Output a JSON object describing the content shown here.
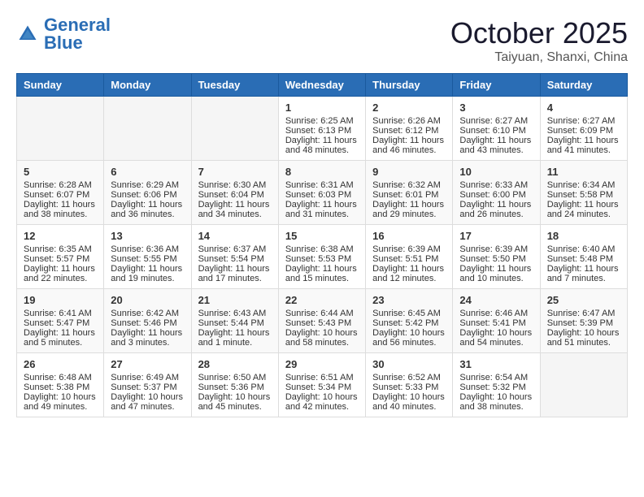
{
  "header": {
    "logo_general": "General",
    "logo_blue": "Blue",
    "month_title": "October 2025",
    "location": "Taiyuan, Shanxi, China"
  },
  "days_of_week": [
    "Sunday",
    "Monday",
    "Tuesday",
    "Wednesday",
    "Thursday",
    "Friday",
    "Saturday"
  ],
  "weeks": [
    [
      {
        "day": "",
        "content": ""
      },
      {
        "day": "",
        "content": ""
      },
      {
        "day": "",
        "content": ""
      },
      {
        "day": "1",
        "content": "Sunrise: 6:25 AM\nSunset: 6:13 PM\nDaylight: 11 hours and 48 minutes."
      },
      {
        "day": "2",
        "content": "Sunrise: 6:26 AM\nSunset: 6:12 PM\nDaylight: 11 hours and 46 minutes."
      },
      {
        "day": "3",
        "content": "Sunrise: 6:27 AM\nSunset: 6:10 PM\nDaylight: 11 hours and 43 minutes."
      },
      {
        "day": "4",
        "content": "Sunrise: 6:27 AM\nSunset: 6:09 PM\nDaylight: 11 hours and 41 minutes."
      }
    ],
    [
      {
        "day": "5",
        "content": "Sunrise: 6:28 AM\nSunset: 6:07 PM\nDaylight: 11 hours and 38 minutes."
      },
      {
        "day": "6",
        "content": "Sunrise: 6:29 AM\nSunset: 6:06 PM\nDaylight: 11 hours and 36 minutes."
      },
      {
        "day": "7",
        "content": "Sunrise: 6:30 AM\nSunset: 6:04 PM\nDaylight: 11 hours and 34 minutes."
      },
      {
        "day": "8",
        "content": "Sunrise: 6:31 AM\nSunset: 6:03 PM\nDaylight: 11 hours and 31 minutes."
      },
      {
        "day": "9",
        "content": "Sunrise: 6:32 AM\nSunset: 6:01 PM\nDaylight: 11 hours and 29 minutes."
      },
      {
        "day": "10",
        "content": "Sunrise: 6:33 AM\nSunset: 6:00 PM\nDaylight: 11 hours and 26 minutes."
      },
      {
        "day": "11",
        "content": "Sunrise: 6:34 AM\nSunset: 5:58 PM\nDaylight: 11 hours and 24 minutes."
      }
    ],
    [
      {
        "day": "12",
        "content": "Sunrise: 6:35 AM\nSunset: 5:57 PM\nDaylight: 11 hours and 22 minutes."
      },
      {
        "day": "13",
        "content": "Sunrise: 6:36 AM\nSunset: 5:55 PM\nDaylight: 11 hours and 19 minutes."
      },
      {
        "day": "14",
        "content": "Sunrise: 6:37 AM\nSunset: 5:54 PM\nDaylight: 11 hours and 17 minutes."
      },
      {
        "day": "15",
        "content": "Sunrise: 6:38 AM\nSunset: 5:53 PM\nDaylight: 11 hours and 15 minutes."
      },
      {
        "day": "16",
        "content": "Sunrise: 6:39 AM\nSunset: 5:51 PM\nDaylight: 11 hours and 12 minutes."
      },
      {
        "day": "17",
        "content": "Sunrise: 6:39 AM\nSunset: 5:50 PM\nDaylight: 11 hours and 10 minutes."
      },
      {
        "day": "18",
        "content": "Sunrise: 6:40 AM\nSunset: 5:48 PM\nDaylight: 11 hours and 7 minutes."
      }
    ],
    [
      {
        "day": "19",
        "content": "Sunrise: 6:41 AM\nSunset: 5:47 PM\nDaylight: 11 hours and 5 minutes."
      },
      {
        "day": "20",
        "content": "Sunrise: 6:42 AM\nSunset: 5:46 PM\nDaylight: 11 hours and 3 minutes."
      },
      {
        "day": "21",
        "content": "Sunrise: 6:43 AM\nSunset: 5:44 PM\nDaylight: 11 hours and 1 minute."
      },
      {
        "day": "22",
        "content": "Sunrise: 6:44 AM\nSunset: 5:43 PM\nDaylight: 10 hours and 58 minutes."
      },
      {
        "day": "23",
        "content": "Sunrise: 6:45 AM\nSunset: 5:42 PM\nDaylight: 10 hours and 56 minutes."
      },
      {
        "day": "24",
        "content": "Sunrise: 6:46 AM\nSunset: 5:41 PM\nDaylight: 10 hours and 54 minutes."
      },
      {
        "day": "25",
        "content": "Sunrise: 6:47 AM\nSunset: 5:39 PM\nDaylight: 10 hours and 51 minutes."
      }
    ],
    [
      {
        "day": "26",
        "content": "Sunrise: 6:48 AM\nSunset: 5:38 PM\nDaylight: 10 hours and 49 minutes."
      },
      {
        "day": "27",
        "content": "Sunrise: 6:49 AM\nSunset: 5:37 PM\nDaylight: 10 hours and 47 minutes."
      },
      {
        "day": "28",
        "content": "Sunrise: 6:50 AM\nSunset: 5:36 PM\nDaylight: 10 hours and 45 minutes."
      },
      {
        "day": "29",
        "content": "Sunrise: 6:51 AM\nSunset: 5:34 PM\nDaylight: 10 hours and 42 minutes."
      },
      {
        "day": "30",
        "content": "Sunrise: 6:52 AM\nSunset: 5:33 PM\nDaylight: 10 hours and 40 minutes."
      },
      {
        "day": "31",
        "content": "Sunrise: 6:54 AM\nSunset: 5:32 PM\nDaylight: 10 hours and 38 minutes."
      },
      {
        "day": "",
        "content": ""
      }
    ]
  ]
}
